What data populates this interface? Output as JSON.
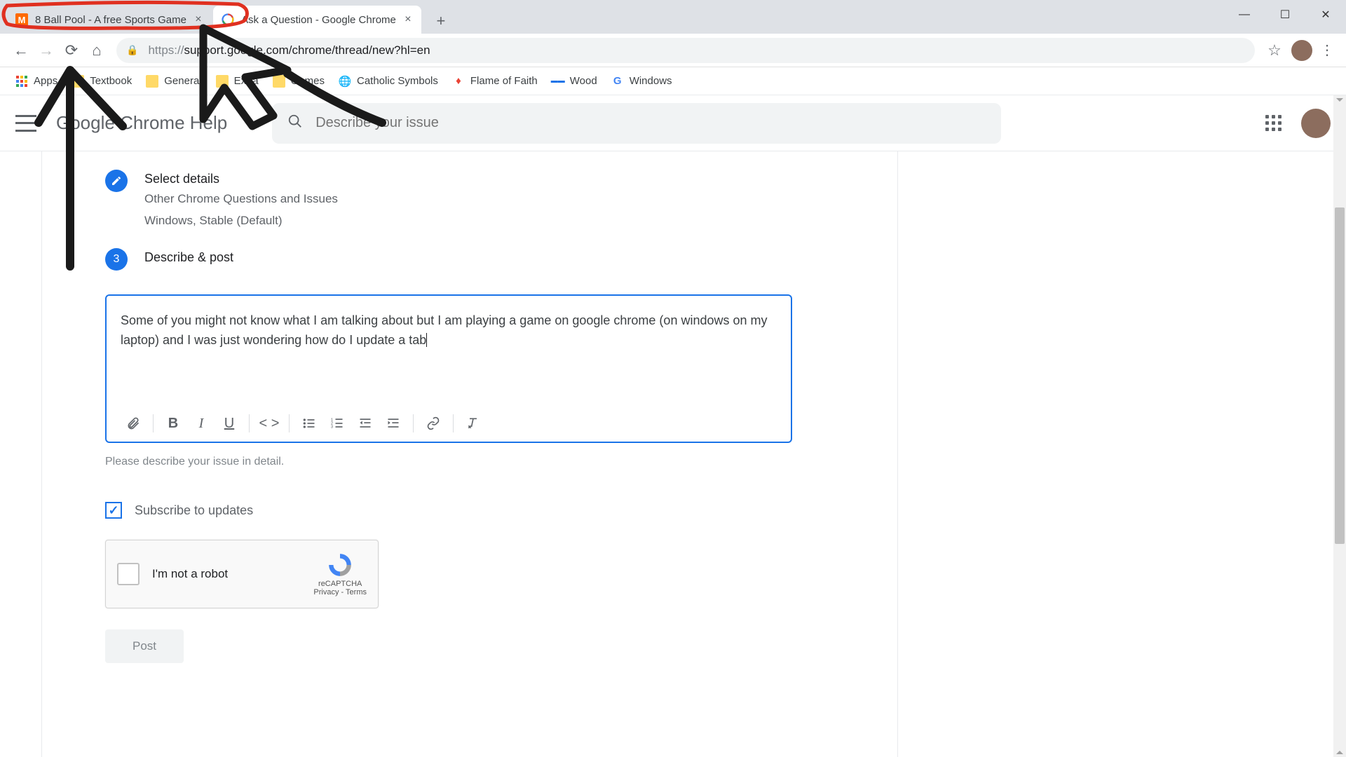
{
  "browser": {
    "tabs": [
      {
        "title": "8 Ball Pool - A free Sports Game",
        "favicon_bg": "#ff6a00",
        "favicon_letter": "M",
        "active": false
      },
      {
        "title": "Ask a Question - Google Chrome",
        "favicon_letter": "G",
        "active": true
      }
    ],
    "url_display": "https://support.google.com/chrome/thread/new?hl=en",
    "url_prefix": "https://",
    "url_main": "support.google.com/chrome/thread/new?hl=en"
  },
  "bookmarks": [
    {
      "label": "Apps",
      "type": "apps"
    },
    {
      "label": "Textbook",
      "type": "folder"
    },
    {
      "label": "General",
      "type": "folder"
    },
    {
      "label": "Extra",
      "type": "folder"
    },
    {
      "label": "Games",
      "type": "folder"
    },
    {
      "label": "Catholic Symbols",
      "type": "icon",
      "emoji": "🌐",
      "color": "#34a853"
    },
    {
      "label": "Flame of Faith",
      "type": "icon",
      "emoji": "🔥",
      "color": "#ea4335"
    },
    {
      "label": "Wood",
      "type": "icon",
      "emoji": "▭",
      "color": "#1a73e8"
    },
    {
      "label": "Windows",
      "type": "icon",
      "emoji": "G",
      "color": "#4285f4"
    }
  ],
  "site": {
    "title": "Google Chrome Help",
    "search_placeholder": "Describe your issue"
  },
  "steps": {
    "select_details": {
      "title": "Select details",
      "line1": "Other Chrome Questions and Issues",
      "line2": "Windows, Stable (Default)"
    },
    "describe": {
      "number": "3",
      "title": "Describe & post"
    }
  },
  "editor": {
    "text": "Some of you might not know what I am talking about but I am playing a game on google chrome (on windows on my laptop) and I was just wondering how do I update a tab",
    "helper": "Please describe your issue in detail."
  },
  "subscribe": {
    "label": "Subscribe to updates",
    "checked": true
  },
  "recaptcha": {
    "label": "I'm not a robot",
    "brand": "reCAPTCHA",
    "footer": "Privacy - Terms"
  },
  "post_button": "Post"
}
